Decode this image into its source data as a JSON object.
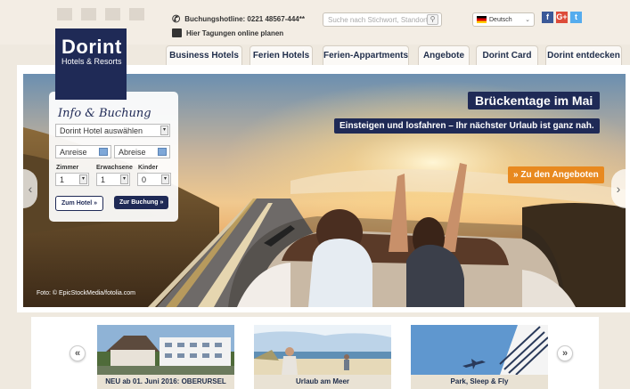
{
  "brand": {
    "name": "Dorint",
    "tagline": "Hotels & Resorts"
  },
  "header": {
    "hotline": "Buchungshotline: 0221 48567-444**",
    "tagungen": "Hier Tagungen online planen",
    "search_placeholder": "Suche nach Stichwort, Standort...",
    "language": "Deutsch"
  },
  "social": [
    "f",
    "G+",
    "t"
  ],
  "nav": [
    "Business Hotels",
    "Ferien Hotels",
    "Ferien-Appartments",
    "Angebote",
    "Dorint Card",
    "Dorint entdecken"
  ],
  "hero": {
    "title": "Brückentage im Mai",
    "subtitle": "Einsteigen und losfahren – Ihr nächster Urlaub ist ganz nah.",
    "cta": "» Zu den Angeboten",
    "credit": "Foto: © EpicStockMedia/fotolia.com"
  },
  "booking": {
    "title": "Info & Buchung",
    "hotel_select": "Dorint Hotel auswählen",
    "arrival": "Anreise",
    "departure": "Abreise",
    "rooms_label": "Zimmer",
    "adults_label": "Erwachsene",
    "children_label": "Kinder",
    "rooms_value": "1",
    "adults_value": "1",
    "children_value": "0",
    "hotel_button": "Zum Hotel »",
    "booking_button": "Zur Buchung »"
  },
  "teasers": [
    {
      "caption": "NEU ab 01. Juni 2016: OBERURSEL"
    },
    {
      "caption": "Urlaub am Meer"
    },
    {
      "caption": "Park, Sleep & Fly"
    }
  ],
  "carousel": {
    "prev": "«",
    "next": "»"
  },
  "colors": {
    "navy": "#1f2a56",
    "orange": "#e8891f",
    "cream": "#efe9df"
  }
}
